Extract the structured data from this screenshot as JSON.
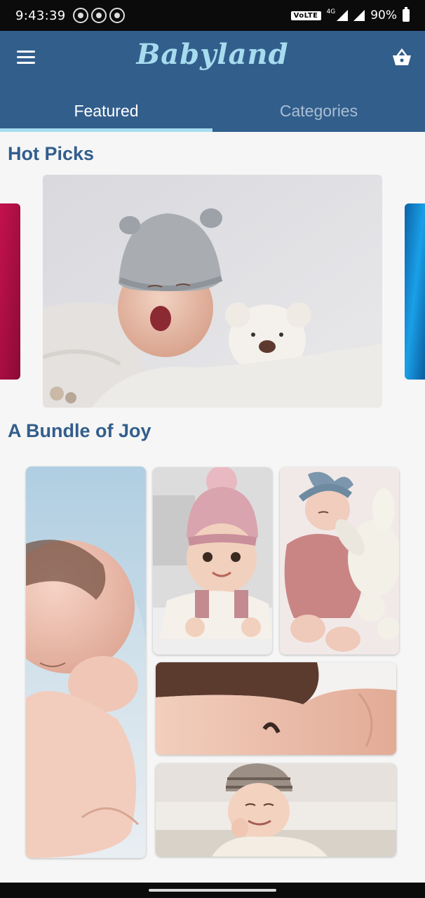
{
  "status_bar": {
    "time": "9:43:39",
    "network_label": "VoLTE",
    "lte_label": "4G",
    "battery": "90%"
  },
  "app_bar": {
    "brand": "Babyland",
    "menu_icon": "hamburger-menu-icon",
    "cart_icon": "basket-icon",
    "colors": {
      "primary": "#325e8c",
      "accent": "#a7dcef"
    }
  },
  "tabs": [
    {
      "label": "Featured",
      "active": true
    },
    {
      "label": "Categories",
      "active": false
    }
  ],
  "sections": {
    "hot_picks": "Hot Picks",
    "bundle_of_joy": "A Bundle of Joy"
  }
}
